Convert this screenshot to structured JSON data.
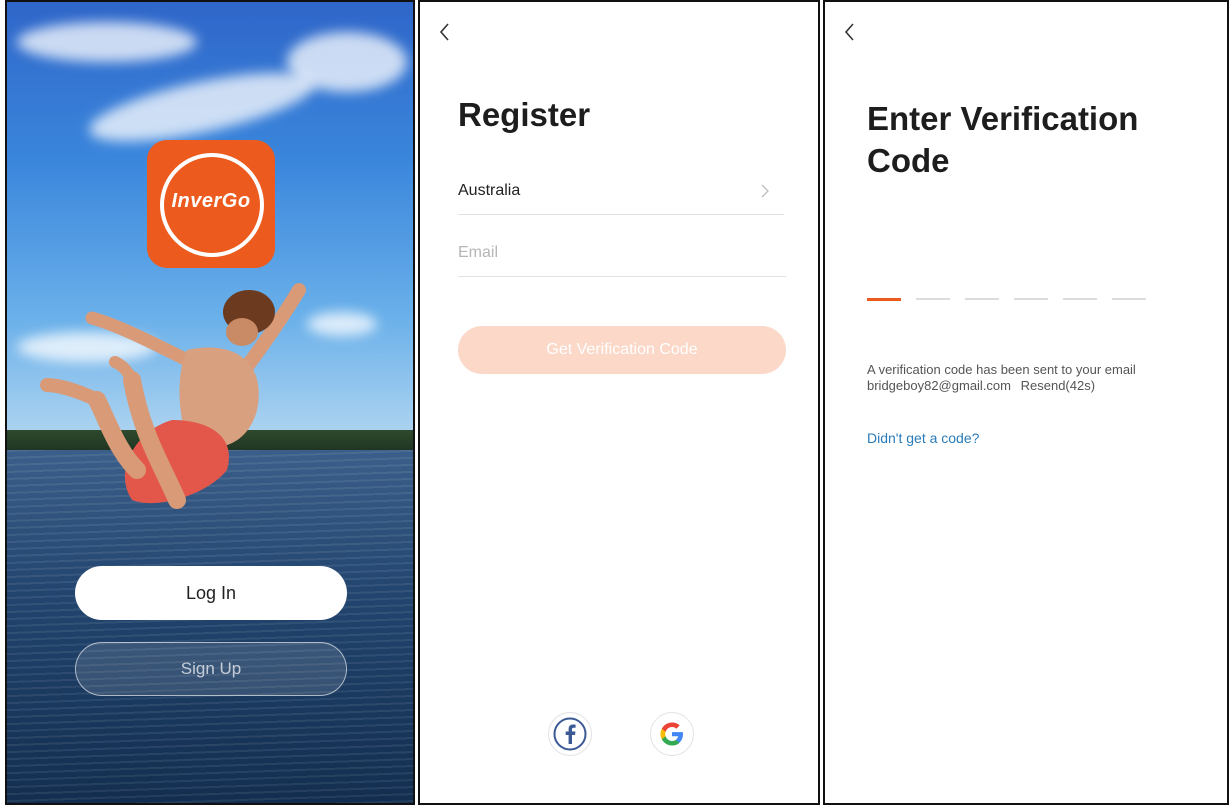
{
  "splash": {
    "logo_text": "InverGo",
    "login_label": "Log In",
    "signup_label": "Sign Up",
    "brand_color": "#ec5a1e"
  },
  "register": {
    "back_icon": "chevron-left-icon",
    "title": "Register",
    "country": "Australia",
    "email_placeholder": "Email",
    "email_value": "",
    "verify_button": "Get Verification Code",
    "social": [
      "facebook-icon",
      "google-icon"
    ]
  },
  "verify": {
    "back_icon": "chevron-left-icon",
    "title": "Enter Verification Code",
    "code_length": 6,
    "info_line1": "A verification code has been sent to your email",
    "email": "bridgeboy82@gmail.com",
    "resend": "Resend(42s)",
    "no_code_link": "Didn't get a code?",
    "accent_color": "#ec5a1e",
    "link_color": "#2a7bb8"
  }
}
